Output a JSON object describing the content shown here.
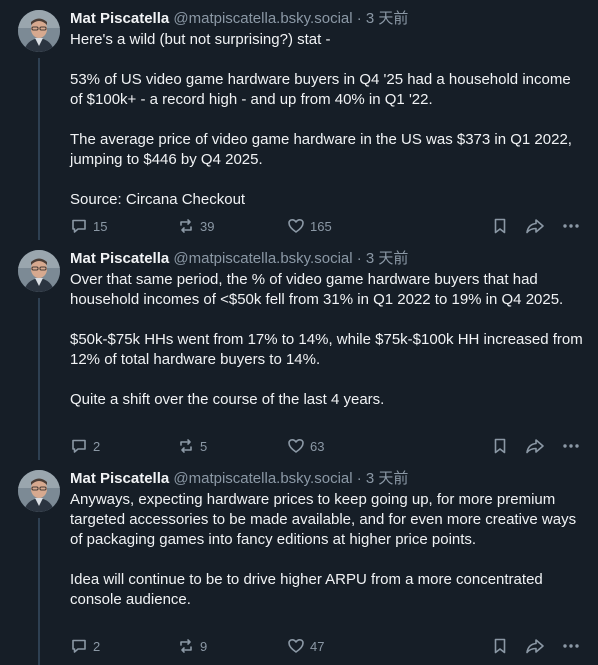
{
  "posts": [
    {
      "author": "Mat Piscatella",
      "handle": "@matpiscatella.bsky.social",
      "time": "· 3 天前",
      "paragraphs": [
        "Here's a wild (but not surprising?) stat -",
        "53% of US video game hardware buyers in Q4 '25 had a household income of $100k+ - a record high - and up from 40% in Q1 '22.",
        "The average price of video game hardware in the US was $373 in Q1 2022, jumping to $446 by Q4 2025.",
        "Source: Circana Checkout"
      ],
      "replies": "15",
      "reposts": "39",
      "likes": "165"
    },
    {
      "author": "Mat Piscatella",
      "handle": "@matpiscatella.bsky.social",
      "time": "· 3 天前",
      "paragraphs": [
        "Over that same period, the % of video game hardware buyers that had household incomes of <$50k fell from 31% in Q1 2022 to 19% in Q4 2025.",
        "$50k-$75k HHs went from 17% to 14%, while $75k-$100k HH increased from 12% of total hardware buyers to 14%.",
        "Quite a shift over the course of the last 4 years."
      ],
      "replies": "2",
      "reposts": "5",
      "likes": "63"
    },
    {
      "author": "Mat Piscatella",
      "handle": "@matpiscatella.bsky.social",
      "time": "· 3 天前",
      "paragraphs": [
        "Anyways, expecting hardware prices to keep going up, for more premium targeted accessories to be made available, and for even more creative ways of packaging games into fancy editions at higher price points.",
        "Idea will continue to be to drive higher ARPU from a more concentrated console audience."
      ],
      "replies": "2",
      "reposts": "9",
      "likes": "47"
    }
  ],
  "colors": {
    "background": "#161e27",
    "text": "#f1f3f5",
    "muted": "#8b98a5",
    "thread_line": "#2e4052"
  }
}
